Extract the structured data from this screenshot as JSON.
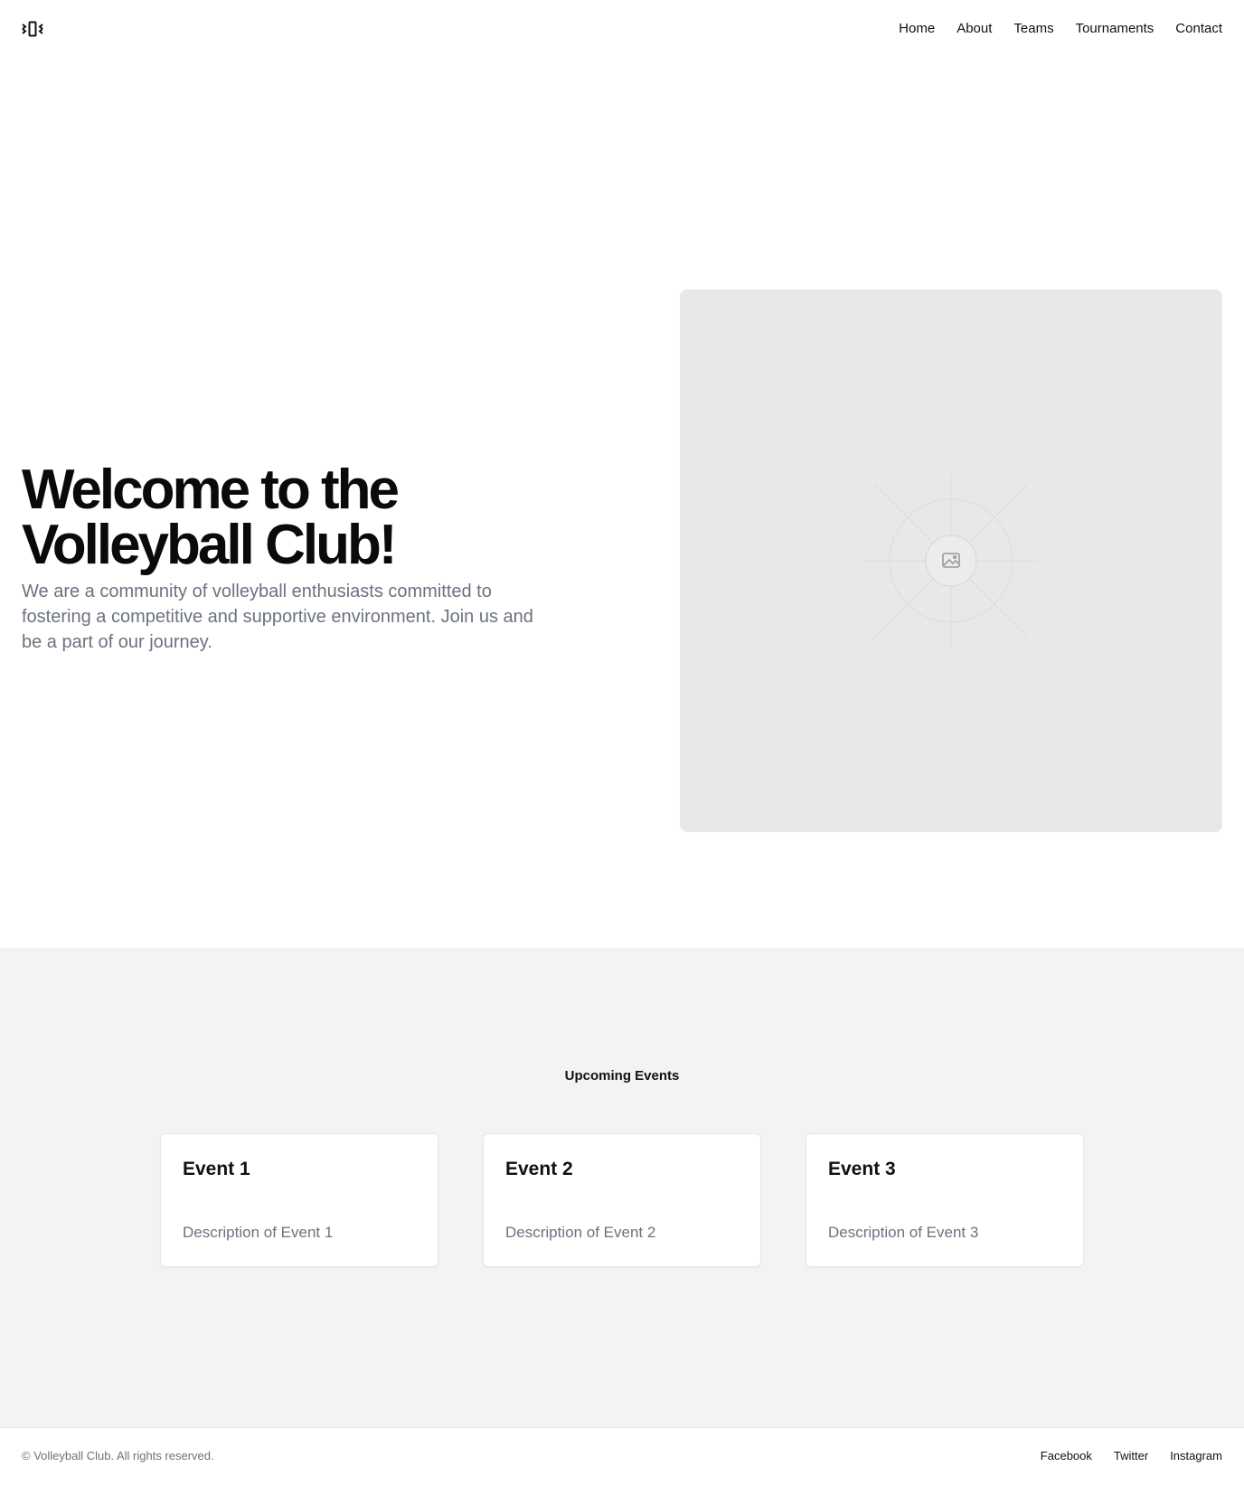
{
  "header": {
    "logo_icon": "volleyball-club-logo-icon",
    "nav": {
      "home": "Home",
      "about": "About",
      "teams": "Teams",
      "tournaments": "Tournaments",
      "contact": "Contact"
    }
  },
  "hero": {
    "title_line1": "Welcome to the",
    "title_line2": "Volleyball Club!",
    "text": "We are a community of volleyball enthusiasts committed to fostering a competitive and supportive environment. Join us and be a part of our journey.",
    "image_icon": "image-placeholder-icon"
  },
  "events": {
    "title": "Upcoming Events",
    "cards": [
      {
        "title": "Event 1",
        "description": "Description of Event 1"
      },
      {
        "title": "Event 2",
        "description": "Description of Event 2"
      },
      {
        "title": "Event 3",
        "description": "Description of Event 3"
      }
    ]
  },
  "footer": {
    "copyright": "© Volleyball Club. All rights reserved.",
    "links": {
      "facebook": "Facebook",
      "twitter": "Twitter",
      "instagram": "Instagram"
    }
  },
  "colors": {
    "text": "#111111",
    "muted": "#6b7280",
    "section_bg": "#f2f3f5",
    "image_bg": "#e8e8e8"
  }
}
